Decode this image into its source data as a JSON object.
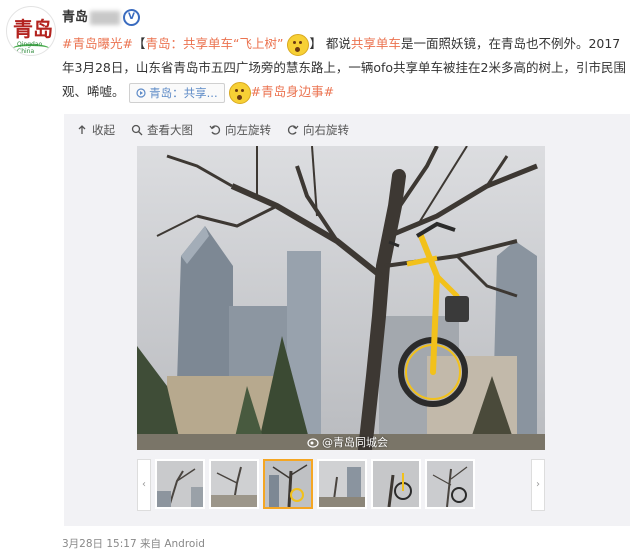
{
  "account": {
    "name": "青岛",
    "avatar_text": "青岛",
    "avatar_sub": "Qingdao China"
  },
  "post": {
    "topic_1": "#青岛曝光#",
    "headline_open": "【",
    "headline_link": "青岛：共享单车“飞上树”",
    "headline_close": "】",
    "body_1": "都说",
    "body_link": "共享单车",
    "body_2": "是一面照妖镜，在青岛也不例外。2017年3月28日，山东省青岛市五四广场旁的慧东路上，一辆ofo共享单车被挂在2米多高的树上，引市民围观、唏嘘。",
    "chip_label": "青岛：共享...",
    "topic_2": "#青岛身边事#"
  },
  "toolbar": {
    "collapse": "收起",
    "view_large": "查看大图",
    "rotate_left": "向左旋转",
    "rotate_right": "向右旋转"
  },
  "photo": {
    "watermark": "@青岛同城会"
  },
  "thumbnails": {
    "prev": "‹",
    "next": "›",
    "count": 6,
    "active_index": 2
  },
  "footer": {
    "timestamp": "3月28日 15:17",
    "source": "来自 Android"
  },
  "colors": {
    "link": "#eb7350",
    "chip_text": "#5e8bc7",
    "bike_yellow": "#f2c11b"
  }
}
